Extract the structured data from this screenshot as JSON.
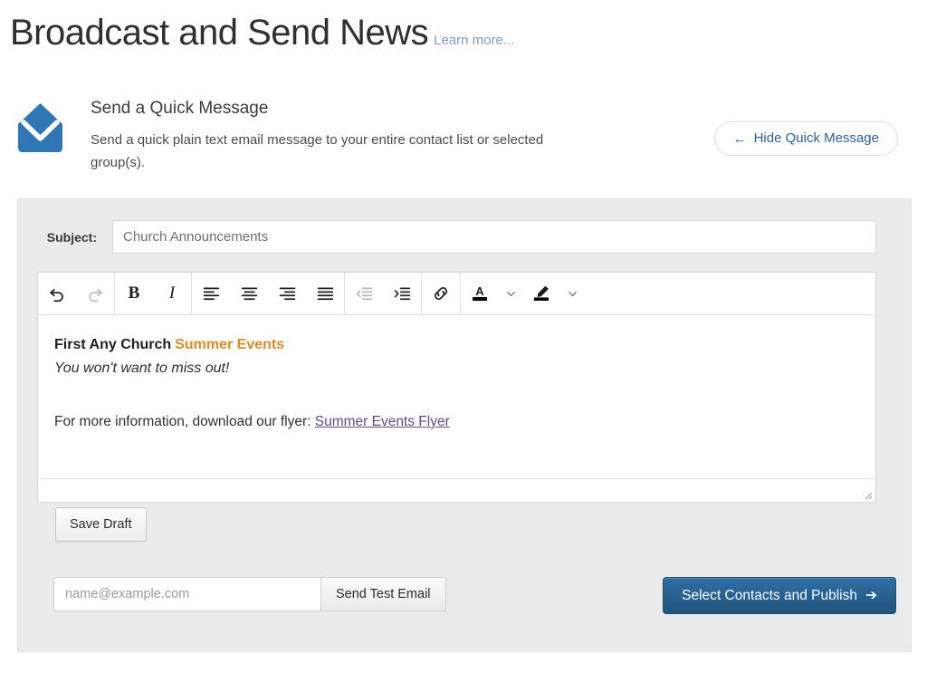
{
  "header": {
    "title": "Broadcast and Send News",
    "learn_more": "Learn more..."
  },
  "intro": {
    "icon": "envelope-icon",
    "title": "Send a Quick Message",
    "description": "Send a quick plain text email message to your entire contact list or selected group(s).",
    "hide_button": {
      "arrow": "←",
      "label": "Hide Quick Message"
    }
  },
  "form": {
    "subject": {
      "label": "Subject:",
      "value": "Church Announcements",
      "placeholder": "Church Announcements"
    },
    "toolbar": {
      "groups": [
        {
          "name": "history",
          "buttons": [
            {
              "name": "undo-icon",
              "title": "Undo",
              "state": "enabled"
            },
            {
              "name": "redo-icon",
              "title": "Redo",
              "state": "disabled"
            }
          ]
        },
        {
          "name": "text-style",
          "buttons": [
            {
              "name": "bold-icon",
              "title": "Bold",
              "label": "B",
              "state": "enabled"
            },
            {
              "name": "italic-icon",
              "title": "Italic",
              "label": "I",
              "state": "enabled"
            }
          ]
        },
        {
          "name": "alignment",
          "buttons": [
            {
              "name": "align-left-icon",
              "title": "Align left",
              "state": "enabled"
            },
            {
              "name": "align-center-icon",
              "title": "Align center",
              "state": "enabled"
            },
            {
              "name": "align-right-icon",
              "title": "Align right",
              "state": "enabled"
            },
            {
              "name": "align-justify-icon",
              "title": "Justify",
              "state": "enabled"
            }
          ]
        },
        {
          "name": "indentation",
          "buttons": [
            {
              "name": "outdent-icon",
              "title": "Decrease indent",
              "state": "disabled"
            },
            {
              "name": "indent-icon",
              "title": "Increase indent",
              "state": "enabled"
            }
          ]
        },
        {
          "name": "insert",
          "buttons": [
            {
              "name": "link-icon",
              "title": "Insert link",
              "state": "enabled"
            }
          ]
        },
        {
          "name": "colors",
          "buttons": [
            {
              "name": "text-color-icon",
              "title": "Text color",
              "label": "A",
              "swatch": "#000000",
              "state": "enabled"
            },
            {
              "name": "text-color-chevron-down-icon",
              "title": "Text color options",
              "state": "enabled"
            },
            {
              "name": "highlight-color-icon",
              "title": "Highlight color",
              "swatch": "#000000",
              "state": "enabled"
            },
            {
              "name": "highlight-color-chevron-down-icon",
              "title": "Highlight color options",
              "state": "enabled"
            }
          ]
        }
      ]
    },
    "body": {
      "line1_bold": "First Any Church",
      "line1_accent": "Summer Events",
      "line1_accent_color": "#e08a27",
      "line2_italic": "You won't want to miss out!",
      "line3_prefix": "For more information, download our flyer: ",
      "line3_link": "Summer Events Flyer",
      "line3_link_color": "#5d4d80"
    },
    "save_draft_label": "Save Draft",
    "test_email": {
      "value": "",
      "placeholder": "name@example.com",
      "button_label": "Send Test Email"
    },
    "publish": {
      "label": "Select Contacts and Publish",
      "arrow": "➔"
    }
  },
  "colors": {
    "brand_blue": "#2b6ca3",
    "panel_bg": "#ebebeb",
    "link_blue": "#7e9dc4"
  }
}
